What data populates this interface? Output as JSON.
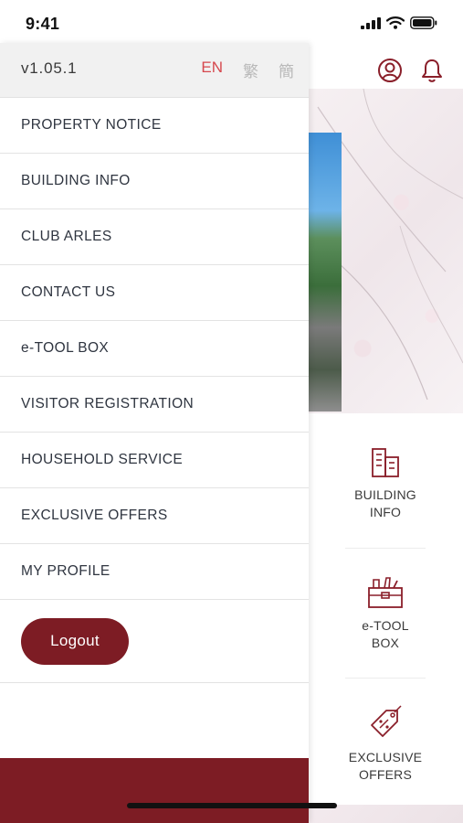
{
  "status_bar": {
    "time": "9:41"
  },
  "drawer": {
    "version": "v1.05.1",
    "languages": [
      {
        "label": "EN",
        "active": true
      },
      {
        "label": "繁",
        "active": false
      },
      {
        "label": "簡",
        "active": false
      }
    ],
    "menu": [
      {
        "label": "PROPERTY NOTICE"
      },
      {
        "label": "BUILDING INFO"
      },
      {
        "label": "CLUB ARLES"
      },
      {
        "label": "CONTACT US"
      },
      {
        "label": "e-TOOL BOX"
      },
      {
        "label": "VISITOR REGISTRATION"
      },
      {
        "label": "HOUSEHOLD SERVICE"
      },
      {
        "label": "EXCLUSIVE OFFERS"
      },
      {
        "label": "MY PROFILE"
      }
    ],
    "logout_label": "Logout"
  },
  "background": {
    "top_icons": [
      "profile-icon",
      "bell-icon"
    ],
    "quick_links": [
      {
        "label": "BUILDING\nINFO",
        "icon": "building-icon"
      },
      {
        "label": "e-TOOL\nBOX",
        "icon": "toolbox-icon"
      },
      {
        "label": "EXCLUSIVE\nOFFERS",
        "icon": "tag-icon"
      }
    ]
  },
  "colors": {
    "brand": "#7d1c24",
    "active_language": "#d6484e",
    "icon": "#8a1f2a"
  }
}
